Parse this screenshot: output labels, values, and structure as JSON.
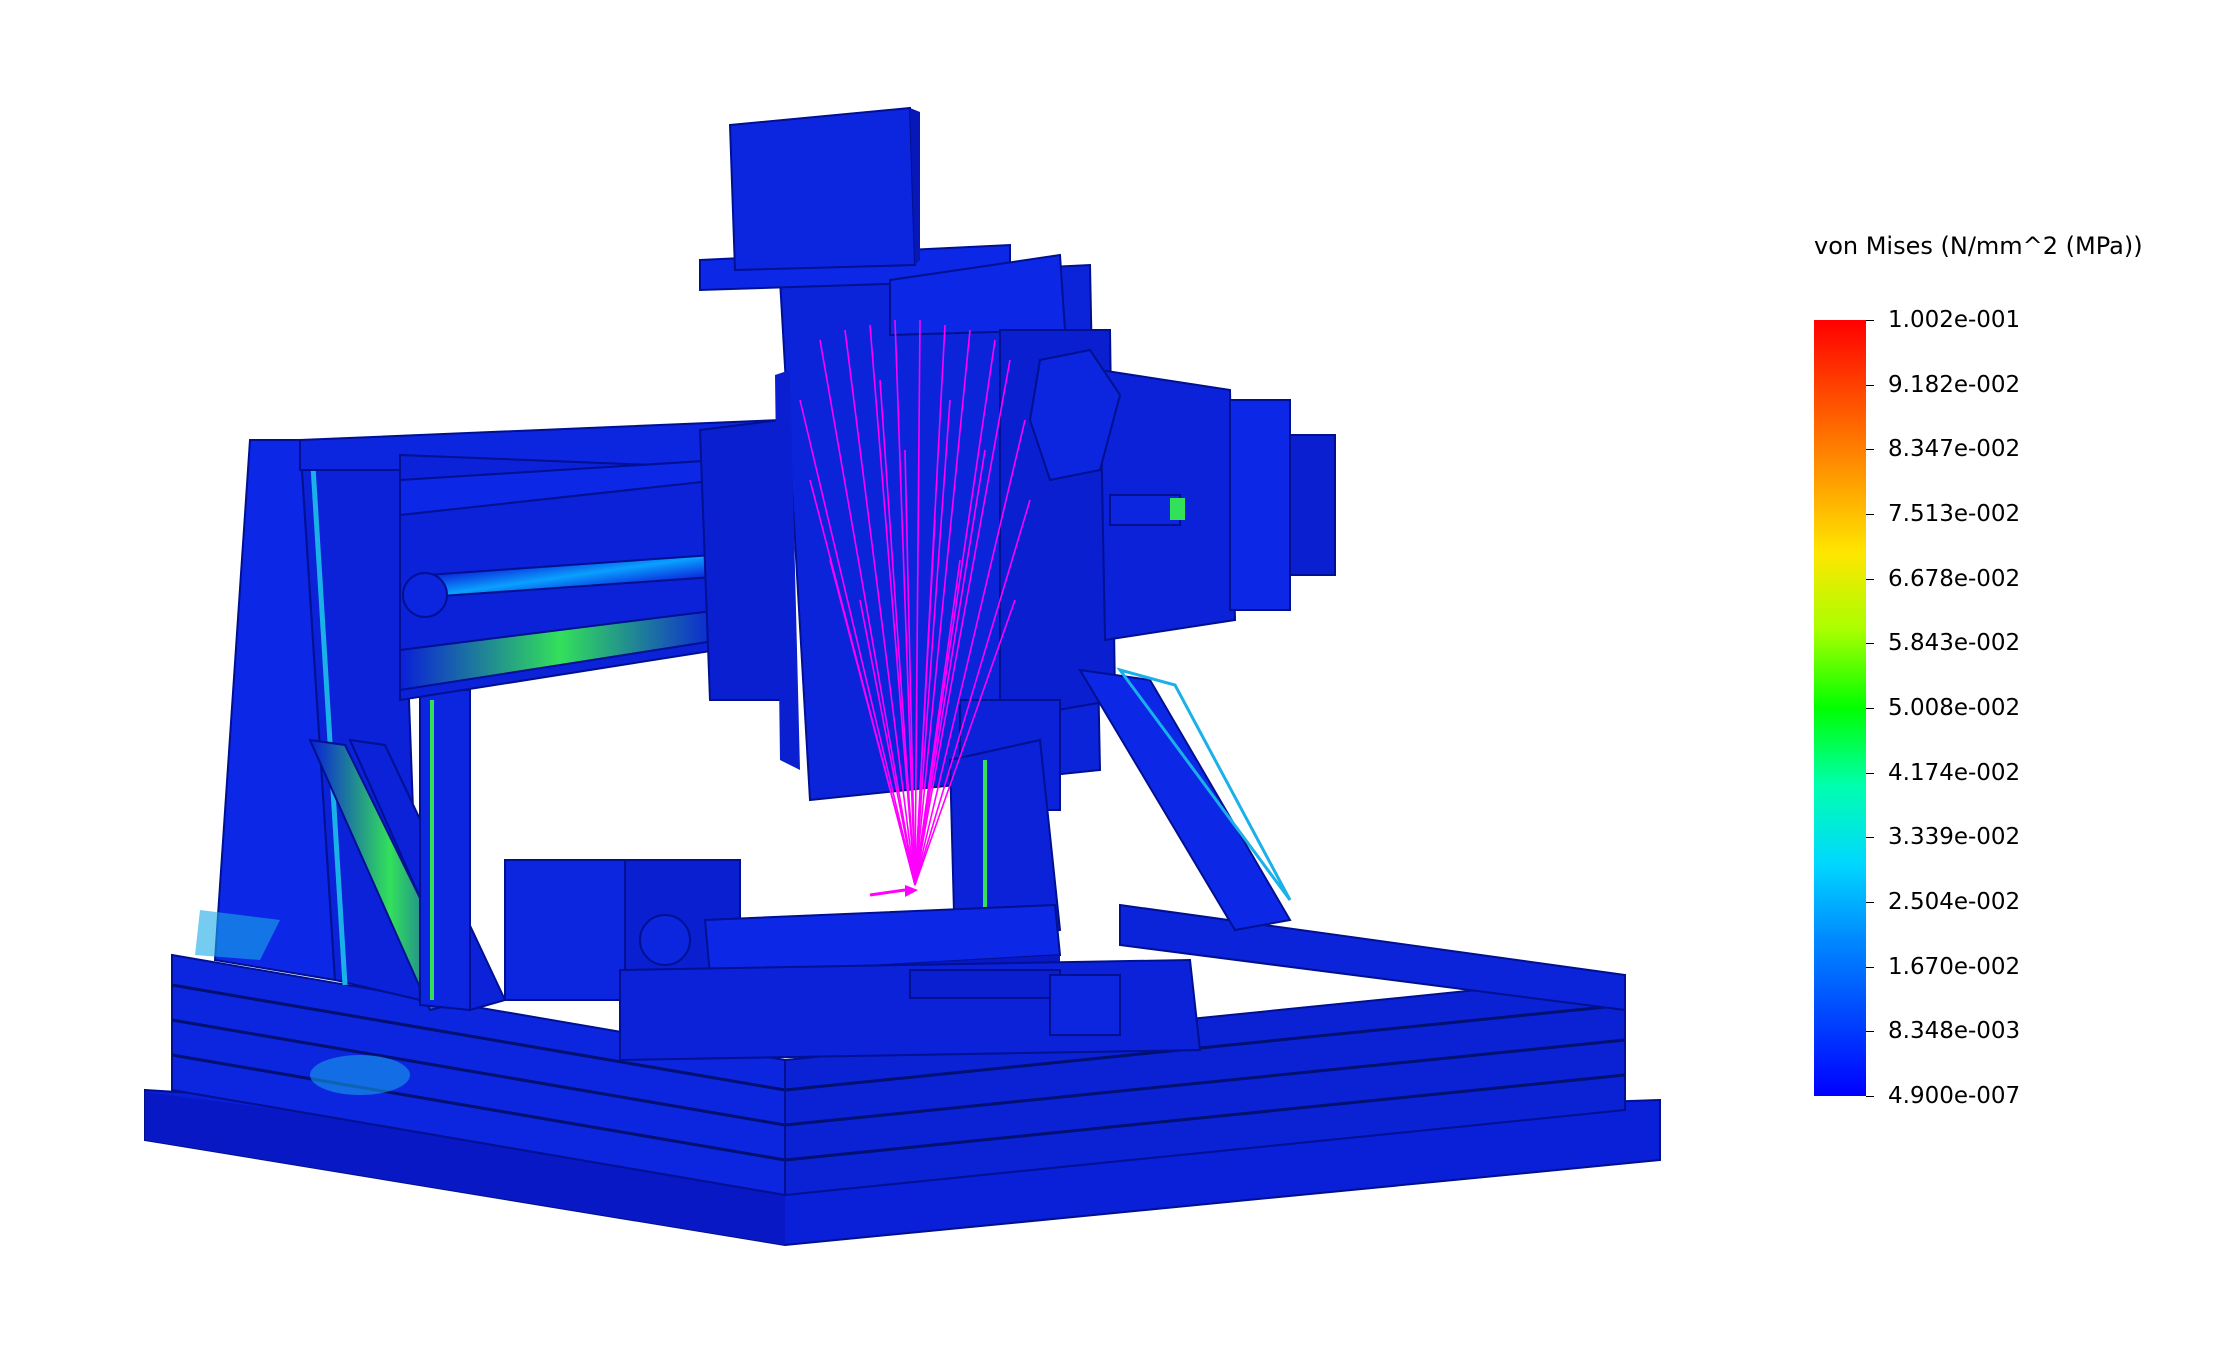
{
  "legend": {
    "title": "von Mises (N/mm^2 (MPa))",
    "ticks": [
      "1.002e-001",
      "9.182e-002",
      "8.347e-002",
      "7.513e-002",
      "6.678e-002",
      "5.843e-002",
      "5.008e-002",
      "4.174e-002",
      "3.339e-002",
      "2.504e-002",
      "1.670e-002",
      "8.348e-003",
      "4.900e-007"
    ]
  },
  "colors": {
    "body": "#0a1fd8",
    "force_vectors": "#ff00ff"
  }
}
